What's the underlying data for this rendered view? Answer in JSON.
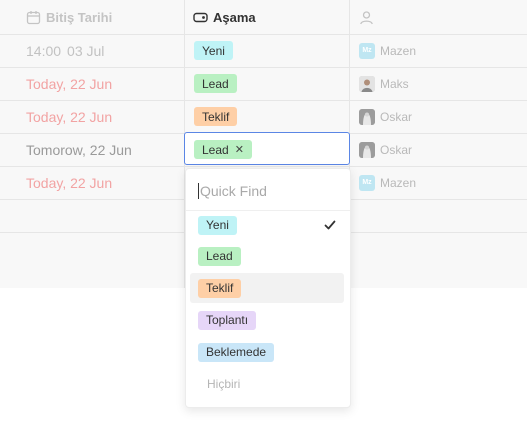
{
  "columns": {
    "due_date": "Bitiş Tarihi",
    "stage": "Aşama"
  },
  "rows": [
    {
      "time": "14:00",
      "date": "03 Jul",
      "stage": "Yeni",
      "person": "Mazen",
      "initials": "Mz"
    },
    {
      "date": "Today, 22 Jun",
      "stage": "Lead",
      "person": "Maks"
    },
    {
      "date": "Today, 22 Jun",
      "stage": "Teklif",
      "person": "Oskar"
    },
    {
      "date": "Tomorow, 22 Jun",
      "stage": "Lead",
      "person": "Oskar"
    },
    {
      "date": "Today, 22 Jun",
      "person": "Mazen",
      "initials": "Mz"
    }
  ],
  "dropdown": {
    "placeholder": "Quick Find",
    "options": [
      {
        "label": "Yeni",
        "color": "#bff3f6",
        "selected": true
      },
      {
        "label": "Lead",
        "color": "#b9f0c2"
      },
      {
        "label": "Teklif",
        "color": "#fecfa6",
        "hovered": true
      },
      {
        "label": "Toplantı",
        "color": "#e6d6f8"
      },
      {
        "label": "Beklemede",
        "color": "#c9e6f8"
      }
    ],
    "none_label": "Hiçbiri"
  },
  "icons": {
    "due_date_header": "calendar-icon",
    "stage_header": "tag-icon",
    "assignee_header": "user-icon",
    "selected_option": "check-icon",
    "remove_tag": "close-icon"
  },
  "colors": {
    "focus_border": "#5b86e5",
    "overdue_date": "#f2a3a3"
  }
}
